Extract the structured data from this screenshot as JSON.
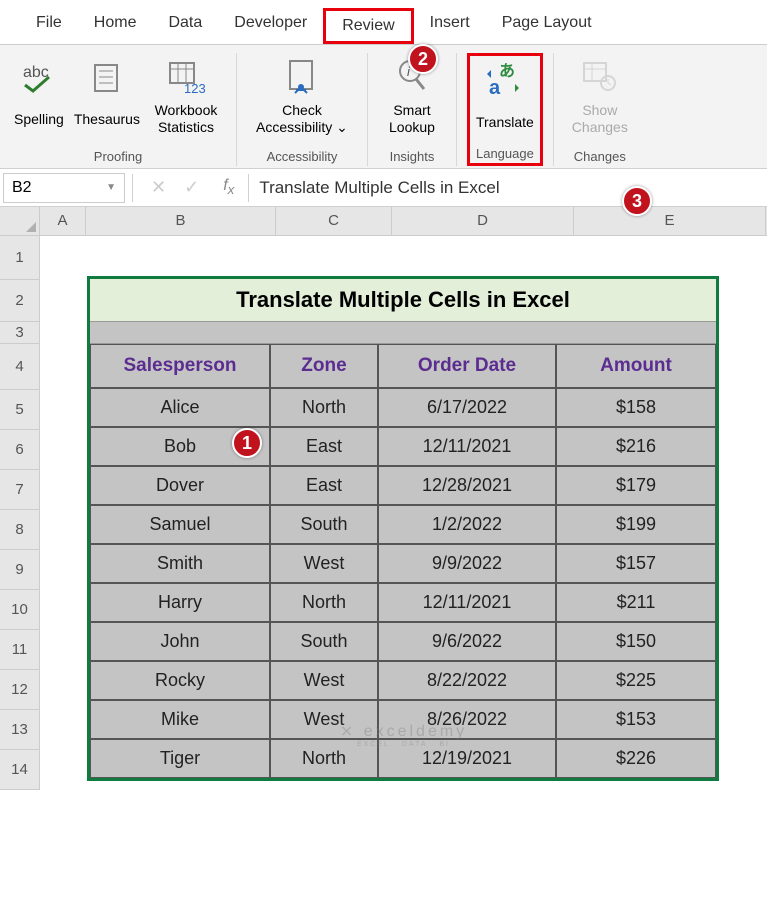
{
  "tabs": [
    "File",
    "Home",
    "Data",
    "Developer",
    "Review",
    "Insert",
    "Page Layout"
  ],
  "ribbon": {
    "groups": [
      {
        "label": "Proofing",
        "items": [
          {
            "label": "Spelling",
            "icon": "spelling"
          },
          {
            "label": "Thesaurus",
            "icon": "thesaurus"
          },
          {
            "label": "Workbook Statistics",
            "icon": "stats"
          }
        ]
      },
      {
        "label": "Accessibility",
        "items": [
          {
            "label": "Check Accessibility ⌄",
            "icon": "accessibility"
          }
        ]
      },
      {
        "label": "Insights",
        "items": [
          {
            "label": "Smart Lookup",
            "icon": "lookup"
          }
        ]
      },
      {
        "label": "Language",
        "items": [
          {
            "label": "Translate",
            "icon": "translate"
          }
        ]
      },
      {
        "label": "Changes",
        "items": [
          {
            "label": "Show Changes",
            "icon": "changes",
            "disabled": true
          }
        ]
      }
    ]
  },
  "name_box": "B2",
  "formula_text": "Translate Multiple Cells in Excel",
  "columns": [
    "A",
    "B",
    "C",
    "D",
    "E"
  ],
  "row_numbers": [
    "1",
    "2",
    "3",
    "4",
    "5",
    "6",
    "7",
    "8",
    "9",
    "10",
    "11",
    "12",
    "13",
    "14"
  ],
  "table": {
    "title": "Translate Multiple Cells in Excel",
    "headers": [
      "Salesperson",
      "Zone",
      "Order Date",
      "Amount"
    ],
    "rows": [
      [
        "Alice",
        "North",
        "6/17/2022",
        "$158"
      ],
      [
        "Bob",
        "East",
        "12/11/2021",
        "$216"
      ],
      [
        "Dover",
        "East",
        "12/28/2021",
        "$179"
      ],
      [
        "Samuel",
        "South",
        "1/2/2022",
        "$199"
      ],
      [
        "Smith",
        "West",
        "9/9/2022",
        "$157"
      ],
      [
        "Harry",
        "North",
        "12/11/2021",
        "$211"
      ],
      [
        "John",
        "South",
        "9/6/2022",
        "$150"
      ],
      [
        "Rocky",
        "West",
        "8/22/2022",
        "$225"
      ],
      [
        "Mike",
        "West",
        "8/26/2022",
        "$153"
      ],
      [
        "Tiger",
        "North",
        "12/19/2021",
        "$226"
      ]
    ]
  },
  "badges": {
    "1": "1",
    "2": "2",
    "3": "3"
  },
  "watermark": {
    "main": "⨯ exceldemy",
    "sub": "EXCEL · DATA · BI"
  },
  "row_heights": {
    "default": 40,
    "first": 44,
    "title": 42
  }
}
